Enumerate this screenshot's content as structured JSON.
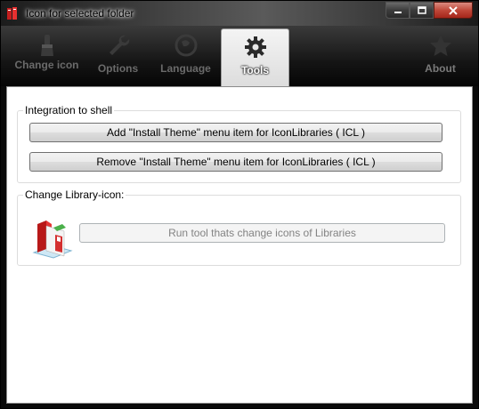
{
  "window": {
    "title": "Icon for selected folder"
  },
  "caption": {
    "minimize_icon": "minimize-icon",
    "maximize_icon": "maximize-icon",
    "close_icon": "close-icon"
  },
  "tabs": [
    {
      "label": "Change icon",
      "icon": "brush-icon",
      "active": false
    },
    {
      "label": "Options",
      "icon": "wrench-icon",
      "active": false
    },
    {
      "label": "Language",
      "icon": "globe-icon",
      "active": false
    },
    {
      "label": "Tools",
      "icon": "gear-icon",
      "active": true
    },
    {
      "label": "About",
      "icon": "star-icon",
      "active": false
    }
  ],
  "integration": {
    "title": "Integration to shell",
    "add_label": "Add \"Install Theme\" menu item for IconLibraries ( ICL )",
    "remove_label": "Remove \"Install Theme\" menu item for IconLibraries ( ICL )"
  },
  "library": {
    "title": "Change Library-icon:",
    "run_label": "Run tool thats change icons of Libraries",
    "icon": "library-books-icon"
  },
  "colors": {
    "close_red": "#c0483a",
    "titlebar_dark": "#1c1c1c",
    "active_tab": "#f4f4f4"
  }
}
